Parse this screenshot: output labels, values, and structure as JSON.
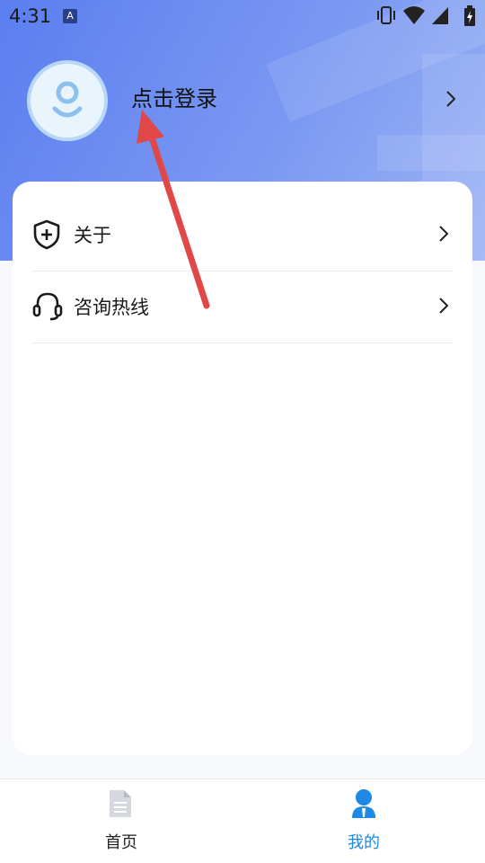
{
  "status_bar": {
    "time": "4:31",
    "notification_glyph": "A"
  },
  "profile": {
    "login_label": "点击登录"
  },
  "menu": {
    "items": [
      {
        "label": "关于",
        "icon": "shield-plus-icon"
      },
      {
        "label": "咨询热线",
        "icon": "headset-icon"
      }
    ]
  },
  "tabbar": {
    "tabs": [
      {
        "label": "首页",
        "icon": "document-icon",
        "active": false
      },
      {
        "label": "我的",
        "icon": "user-icon",
        "active": true
      }
    ]
  },
  "colors": {
    "accent": "#1e88e5",
    "header_gradient_start": "#5b7ef0",
    "arrow": "#e04848"
  }
}
